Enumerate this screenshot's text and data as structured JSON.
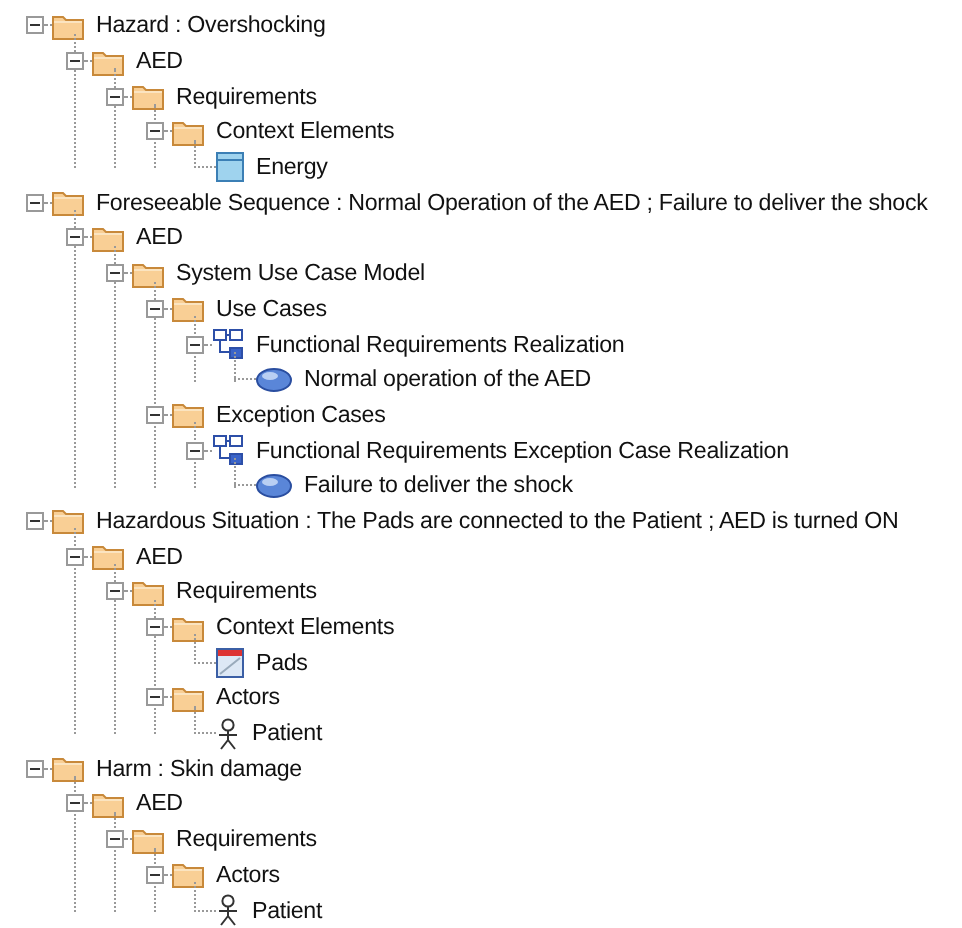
{
  "tree": [
    {
      "label": "Hazard : Overshocking",
      "kind": "folder",
      "expanded": true,
      "children": [
        {
          "label": "AED",
          "kind": "folder",
          "expanded": true,
          "children": [
            {
              "label": "Requirements",
              "kind": "folder",
              "expanded": true,
              "children": [
                {
                  "label": "Context Elements",
                  "kind": "folder",
                  "expanded": true,
                  "children": [
                    {
                      "label": "Energy",
                      "kind": "block"
                    }
                  ]
                }
              ]
            }
          ]
        }
      ]
    },
    {
      "label": "Foreseeable Sequence : Normal Operation of the AED ; Failure to deliver the shock",
      "kind": "folder",
      "expanded": true,
      "children": [
        {
          "label": "AED",
          "kind": "folder",
          "expanded": true,
          "children": [
            {
              "label": "System Use Case Model",
              "kind": "folder",
              "expanded": true,
              "children": [
                {
                  "label": "Use Cases",
                  "kind": "folder",
                  "expanded": true,
                  "children": [
                    {
                      "label": "Functional Requirements Realization",
                      "kind": "realization",
                      "expanded": true,
                      "children": [
                        {
                          "label": "Normal operation of the AED",
                          "kind": "use_case"
                        }
                      ]
                    }
                  ]
                },
                {
                  "label": "Exception Cases",
                  "kind": "folder",
                  "expanded": true,
                  "children": [
                    {
                      "label": "Functional Requirements Exception Case Realization",
                      "kind": "realization",
                      "expanded": true,
                      "children": [
                        {
                          "label": "Failure to deliver the shock",
                          "kind": "use_case"
                        }
                      ]
                    }
                  ]
                }
              ]
            }
          ]
        }
      ]
    },
    {
      "label": "Hazardous Situation : The Pads are connected to the Patient ; AED is turned ON",
      "kind": "folder",
      "expanded": true,
      "children": [
        {
          "label": "AED",
          "kind": "folder",
          "expanded": true,
          "children": [
            {
              "label": "Requirements",
              "kind": "folder",
              "expanded": true,
              "children": [
                {
                  "label": "Context Elements",
                  "kind": "folder",
                  "expanded": true,
                  "children": [
                    {
                      "label": "Pads",
                      "kind": "part"
                    }
                  ]
                },
                {
                  "label": "Actors",
                  "kind": "folder",
                  "expanded": true,
                  "children": [
                    {
                      "label": "Patient",
                      "kind": "actor"
                    }
                  ]
                }
              ]
            }
          ]
        }
      ]
    },
    {
      "label": "Harm : Skin damage",
      "kind": "folder",
      "expanded": true,
      "children": [
        {
          "label": "AED",
          "kind": "folder",
          "expanded": true,
          "children": [
            {
              "label": "Requirements",
              "kind": "folder",
              "expanded": true,
              "children": [
                {
                  "label": "Actors",
                  "kind": "folder",
                  "expanded": true,
                  "children": [
                    {
                      "label": "Patient",
                      "kind": "actor"
                    }
                  ]
                }
              ]
            }
          ]
        }
      ]
    }
  ]
}
